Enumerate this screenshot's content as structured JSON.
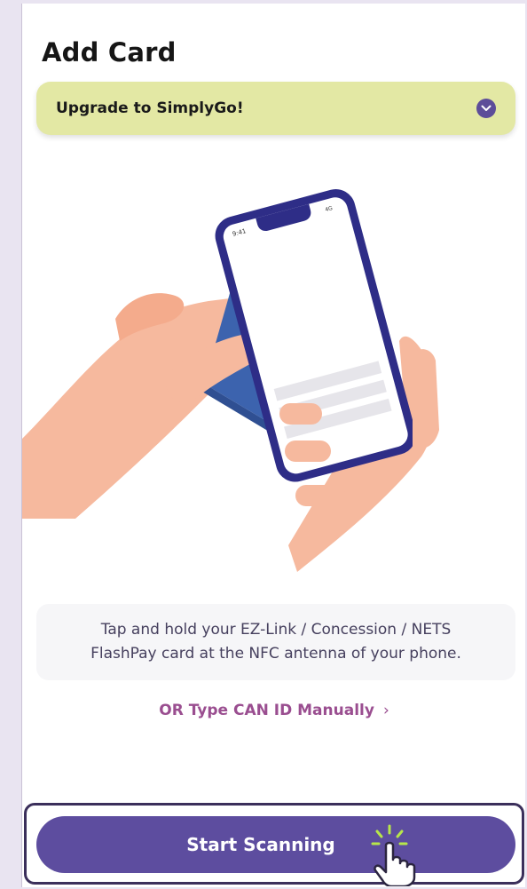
{
  "page": {
    "title": "Add Card"
  },
  "banner": {
    "label": "Upgrade to SimplyGo!",
    "icon": "chevron-down-icon"
  },
  "illustration": {
    "phone_time": "9:41",
    "phone_network": "4G",
    "icon": "nfc-tap-illustration"
  },
  "instruction": {
    "line1": "Tap and hold your EZ-Link / Concession / NETS",
    "line2": "FlashPay card at the NFC antenna of your phone."
  },
  "manual_entry": {
    "label": "OR Type CAN ID Manually",
    "arrow": "›"
  },
  "cta": {
    "label": "Start Scanning",
    "pointer_icon": "hand-pointer-icon"
  },
  "colors": {
    "accent": "#5d4d9f",
    "banner_bg": "#e3e8a4",
    "link": "#9a4e90",
    "frame": "#3b2f5b",
    "phone_frame": "#2e2d87",
    "card": "#3c63ae",
    "skin": "#f6b99e"
  }
}
